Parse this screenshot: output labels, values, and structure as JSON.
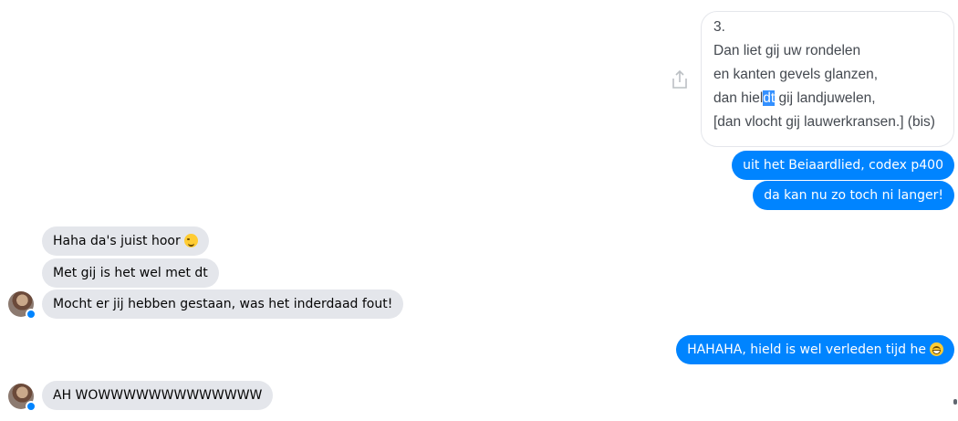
{
  "quoted_message": {
    "lines": [
      "3.",
      "Dan liet gij uw rondelen",
      "en kanten gevels glanzen,",
      "dan hiel",
      "dt",
      " gij landjuwelen,",
      "[dan vlocht gij lauwerkransen.] (bis)"
    ]
  },
  "outgoing_1": "uit het Beiaardlied, codex p400",
  "outgoing_2": "da kan nu zo toch ni langer!",
  "incoming_1": "Haha da's juist hoor",
  "incoming_2": "Met gij is het wel met dt",
  "incoming_3": "Mocht er jij hebben gestaan, was het inderdaad fout!",
  "outgoing_3": "HAHAHA, hield is wel verleden tijd he",
  "incoming_4": "AH WOWWWWWWWWWWWWW",
  "icons": {
    "share": "share-icon",
    "wink": "smiling-face-emoji",
    "laugh": "laughing-face-emoji",
    "messenger_badge": "messenger-badge-icon"
  },
  "colors": {
    "outgoing_bubble": "#0084ff",
    "incoming_bubble": "#e4e6eb",
    "selection": "#3390ff"
  }
}
